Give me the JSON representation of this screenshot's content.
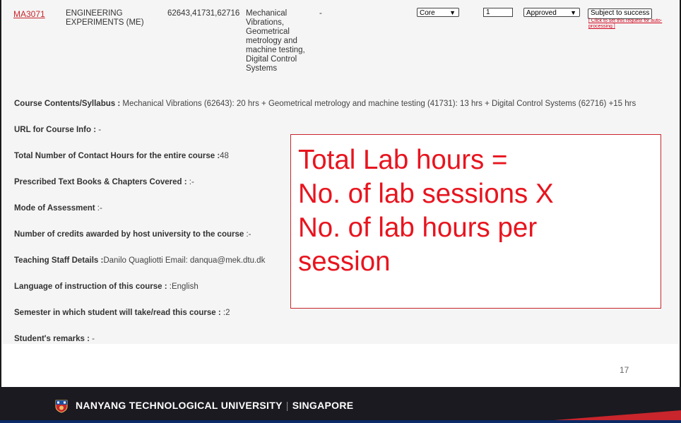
{
  "course": {
    "code": "MA3071",
    "name": "ENGINEERING EXPERIMENTS (ME)",
    "numbers": "62643,41731,62716",
    "topics": "Mechanical Vibrations, Geometrical metrology and machine testing, Digital Control Systems",
    "dash": "-",
    "type_select": "Core",
    "quantity": "1",
    "status_select": "Approved",
    "action_button": "Subject to success",
    "auto_link": "[ Click to set this request for auto-processing ]"
  },
  "fields": [
    {
      "label": "Course Contents/Syllabus : ",
      "value": "Mechanical Vibrations (62643): 20 hrs + Geometrical metrology and machine testing (41731): 13 hrs + Digital Control Systems (62716) +15 hrs"
    },
    {
      "label": "URL for Course Info : ",
      "value": "-"
    },
    {
      "label": "Total Number of Contact Hours for the entire course :",
      "value": "48"
    },
    {
      "label": "Prescribed Text Books & Chapters Covered : ",
      "value": ":-"
    },
    {
      "label": "Mode of Assessment ",
      "value": ":-"
    },
    {
      "label": "Number of credits awarded by host university to the course ",
      "value": ":-"
    },
    {
      "label": "Teaching Staff Details :",
      "value": "Danilo Quagliotti Email: danqua@mek.dtu.dk"
    },
    {
      "label": "Language of instruction of this course : ",
      "value": ":English"
    },
    {
      "label": "Semester in which student will take/read this course : ",
      "value": ":2"
    },
    {
      "label": "Student's remarks : ",
      "value": "-"
    }
  ],
  "callout": {
    "line1": "Total Lab hours =",
    "line2": "No. of lab sessions X",
    "line3": "No. of lab hours per",
    "line4": "session"
  },
  "slide": {
    "page_number": "17",
    "footer_left": "NANYANG TECHNOLOGICAL UNIVERSITY",
    "footer_right": "SINGAPORE"
  },
  "colors": {
    "accent_red": "#e8141e",
    "footer_bg": "#1a1a20",
    "footer_blue": "#0b2a66"
  }
}
